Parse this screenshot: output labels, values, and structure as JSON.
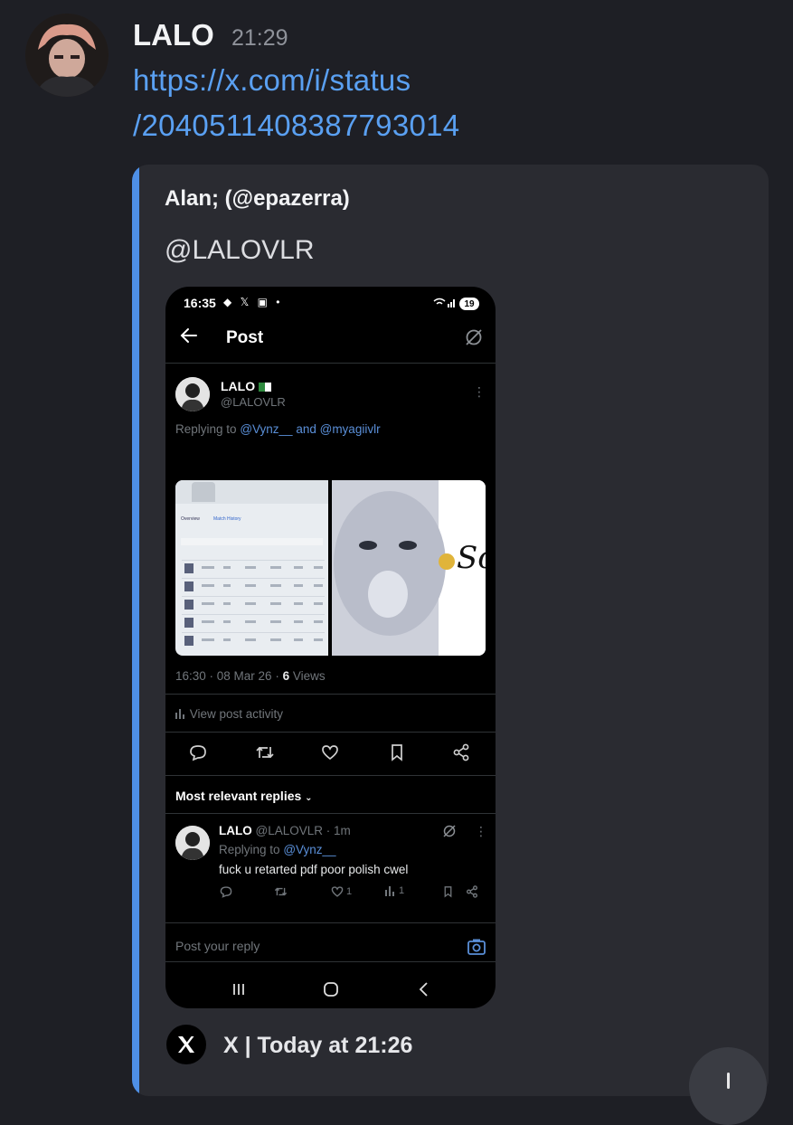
{
  "message": {
    "author": "LALO",
    "time": "21:29",
    "link_line1": "https://x.com/i/status",
    "link_line2": "/2040511408387793014"
  },
  "embed": {
    "author": "Alan; (@epazerra)",
    "description": "@LALOVLR",
    "footer": "X | Today at 21:26",
    "accent_color": "#4e8fe6"
  },
  "phone": {
    "status_time": "16:35",
    "battery": "19",
    "header_title": "Post",
    "post": {
      "name": "LALO",
      "handle": "@LALOVLR",
      "replying_prefix": "Replying to",
      "replying_user1": "@Vynz__",
      "replying_and": "and",
      "replying_user2": "@myagiivlr",
      "meta_prefix": "16:30 · 08 Mar 26 ·",
      "views_count": "6",
      "views_label": "Views",
      "activity_label": "View post activity"
    },
    "replies_header": "Most relevant replies",
    "reply": {
      "name": "LALO",
      "handle_time": "@LALOVLR · 1m",
      "replying_prefix": "Replying to",
      "replying_user": "@Vynz__",
      "text": "fuck u retarted pdf poor polish cwel",
      "likes": "1",
      "views": "1"
    },
    "reply_placeholder": "Post your reply",
    "image_left_tabs": [
      "Overview",
      "Match History"
    ],
    "image_right_text": "Son"
  }
}
